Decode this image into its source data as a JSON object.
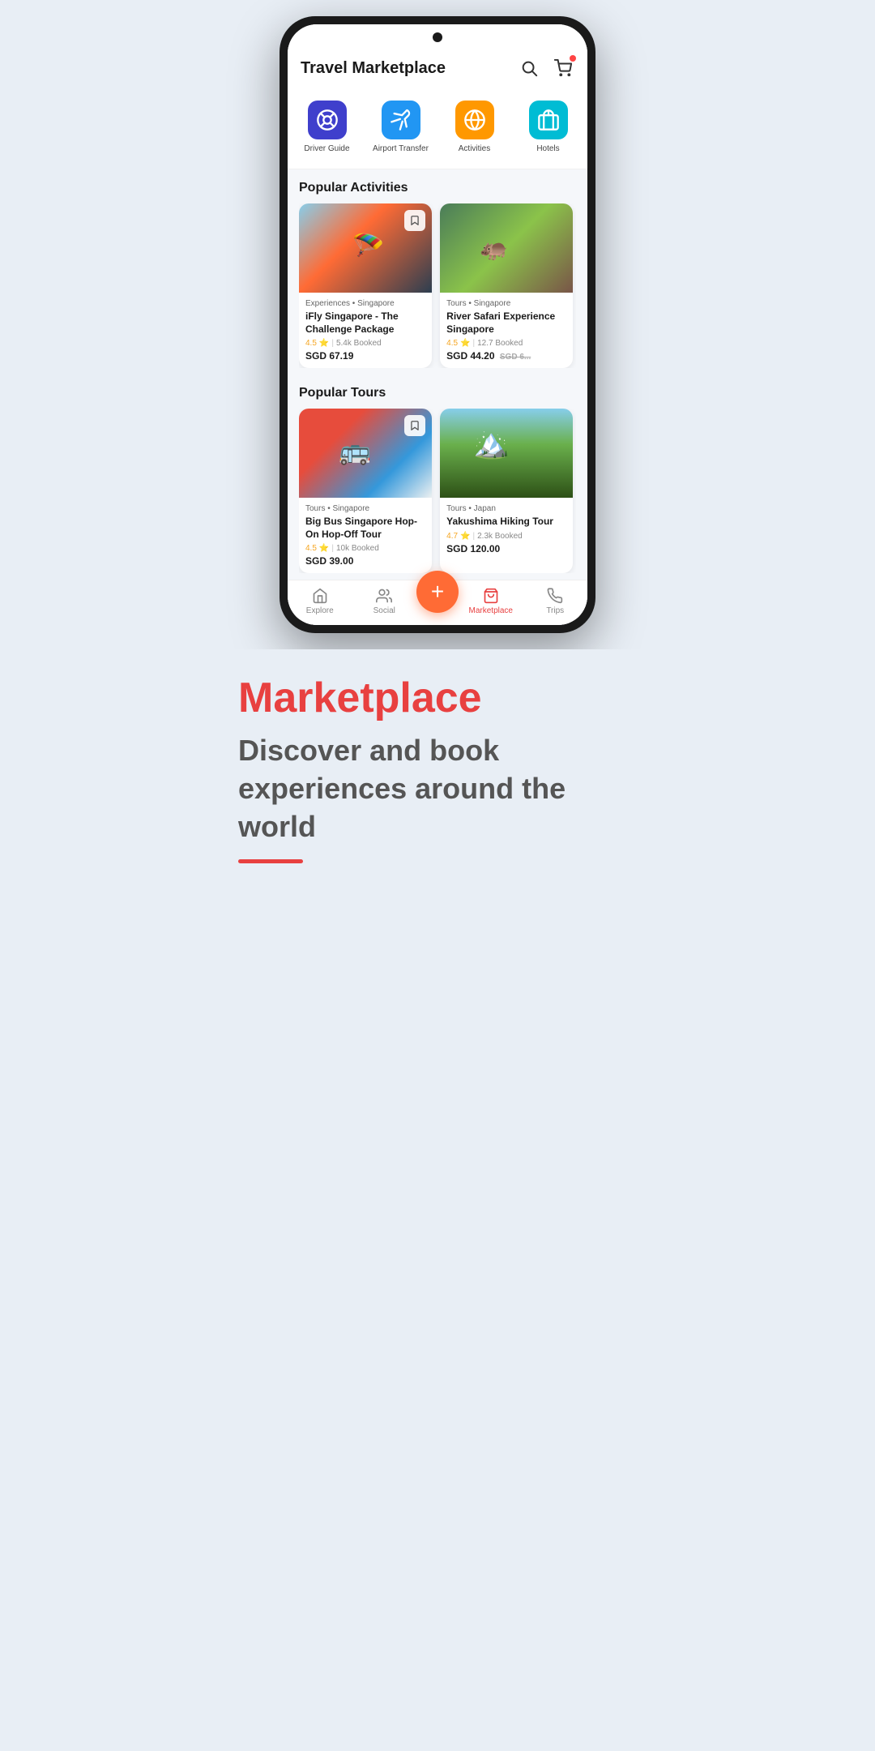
{
  "header": {
    "title": "Travel Marketplace",
    "search_label": "search",
    "cart_label": "cart"
  },
  "categories": [
    {
      "id": "driver-guide",
      "label": "Driver Guide",
      "bg_color": "#3f3fcc",
      "icon": "🚗"
    },
    {
      "id": "airport-transfer",
      "label": "Airport Transfer",
      "bg_color": "#2196f3",
      "icon": "✈️"
    },
    {
      "id": "activities",
      "label": "Activities",
      "bg_color": "#ff9800",
      "icon": "🧭"
    },
    {
      "id": "hotels",
      "label": "Hotels",
      "bg_color": "#00bcd4",
      "icon": "🏨"
    }
  ],
  "popular_activities": {
    "section_title": "Popular Activities",
    "cards": [
      {
        "id": "ifly",
        "subtitle": "Experiences • Singapore",
        "title": "iFly Singapore - The Challenge Package",
        "rating": "4.5",
        "booked": "5.4k Booked",
        "price": "SGD 67.19",
        "original_price": null,
        "img_class": "img-ifly"
      },
      {
        "id": "river-safari",
        "subtitle": "Tours • Singapore",
        "title": "River Safari Experience Singapore",
        "rating": "4.5",
        "booked": "12.7 Booked",
        "price": "SGD 44.20",
        "original_price": "SGD 6...",
        "img_class": "img-safari"
      }
    ]
  },
  "popular_tours": {
    "section_title": "Popular Tours",
    "cards": [
      {
        "id": "big-bus",
        "subtitle": "Tours • Singapore",
        "title": "Big Bus Singapore Hop-On Hop-Off Tour",
        "rating": "4.5",
        "booked": "10k Booked",
        "price": "SGD 39.00",
        "original_price": null,
        "img_class": "img-bus"
      },
      {
        "id": "yakushima",
        "subtitle": "Tours • Japan",
        "title": "Yakushima Hiking Tour",
        "rating": "4.7",
        "booked": "2.3k Booked",
        "price": "SGD 120.00",
        "original_price": null,
        "img_class": "img-mountain"
      }
    ]
  },
  "bottom_nav": {
    "items": [
      {
        "id": "explore",
        "label": "Explore",
        "icon": "🔍",
        "active": false
      },
      {
        "id": "social",
        "label": "Social",
        "icon": "👥",
        "active": false
      },
      {
        "id": "fab",
        "label": "+",
        "active": false
      },
      {
        "id": "marketplace",
        "label": "Marketplace",
        "icon": "🛍️",
        "active": true
      },
      {
        "id": "trips",
        "label": "Trips",
        "icon": "🧳",
        "active": false
      }
    ],
    "fab_label": "+"
  },
  "below_phone": {
    "heading": "Marketplace",
    "description": "Discover and book experiences around the world",
    "accent_color": "#e84040"
  }
}
